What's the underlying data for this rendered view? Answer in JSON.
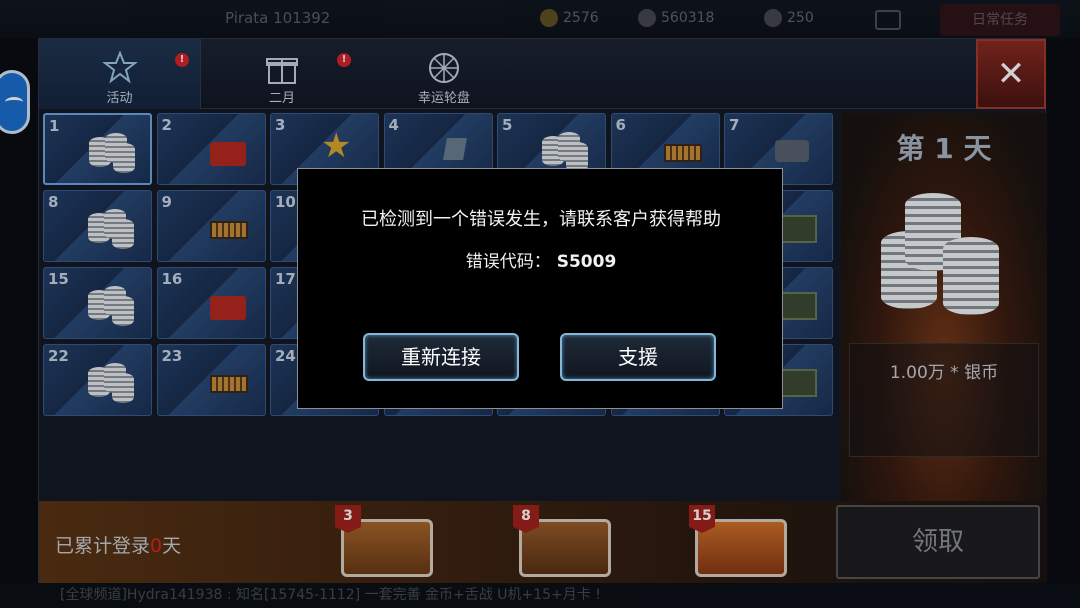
{
  "topbar": {
    "player_name": "Pirata 101392",
    "resource_1": "2576",
    "resource_2": "560318",
    "resource_3": "250",
    "right_button": "日常任务"
  },
  "tabs": [
    {
      "label": "活动",
      "badge": "!"
    },
    {
      "label": "二月",
      "badge": "!"
    },
    {
      "label": "幸运轮盘"
    }
  ],
  "close_label": "✕",
  "grid": {
    "cells": [
      {
        "n": "1",
        "item": "coins"
      },
      {
        "n": "2",
        "item": "toolbox"
      },
      {
        "n": "3",
        "item": "star"
      },
      {
        "n": "4",
        "item": "gem"
      },
      {
        "n": "5",
        "item": "coins"
      },
      {
        "n": "6",
        "item": "ammo"
      },
      {
        "n": "7",
        "item": "robot"
      },
      {
        "n": "8",
        "item": "coins"
      },
      {
        "n": "9",
        "item": "ammo"
      },
      {
        "n": "10",
        "item": ""
      },
      {
        "n": "",
        "item": ""
      },
      {
        "n": "",
        "item": ""
      },
      {
        "n": "",
        "item": ""
      },
      {
        "n": "",
        "item": "crate"
      },
      {
        "n": "15",
        "item": "coins"
      },
      {
        "n": "16",
        "item": "toolbox"
      },
      {
        "n": "17",
        "item": ""
      },
      {
        "n": "",
        "item": ""
      },
      {
        "n": "",
        "item": ""
      },
      {
        "n": "",
        "item": ""
      },
      {
        "n": "",
        "item": "crate"
      },
      {
        "n": "22",
        "item": "coins"
      },
      {
        "n": "23",
        "item": "ammo"
      },
      {
        "n": "24",
        "item": ""
      },
      {
        "n": "",
        "item": ""
      },
      {
        "n": "",
        "item": ""
      },
      {
        "n": "",
        "item": ""
      },
      {
        "n": "",
        "item": "crate"
      }
    ]
  },
  "day_panel": {
    "day_label": "第 1 天",
    "reward_label": "1.00万 * 银币"
  },
  "bottom": {
    "login_prefix": "已累计登录",
    "login_days": "0",
    "login_suffix": "天",
    "chests": [
      {
        "tag": "3"
      },
      {
        "tag": "8"
      },
      {
        "tag": "15"
      }
    ],
    "claim_label": "领取"
  },
  "ticker": "[全球频道]Hydra141938 : 知名[15745-1112] 一套完善 金币+舌战 U机+15+月卡 !",
  "dialog": {
    "message": "已检测到一个错误发生，请联系客户获得帮助",
    "code_label": "错误代码：",
    "code_value": "S5009",
    "reconnect_label": "重新连接",
    "support_label": "支援"
  }
}
